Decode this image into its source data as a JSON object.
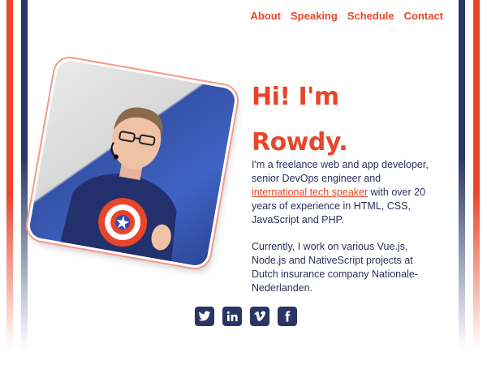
{
  "nav": {
    "items": [
      {
        "label": "About"
      },
      {
        "label": "Speaking"
      },
      {
        "label": "Schedule"
      },
      {
        "label": "Contact"
      }
    ]
  },
  "hero": {
    "heading_line1": "Hi! I'm",
    "heading_line2": "Rowdy.",
    "para1_before": "I'm a freelance web and app developer, senior DevOps engineer and ",
    "para1_link": "international tech speaker",
    "para1_after": " with over 20 years of experience in HTML, CSS, JavaScript and PHP.",
    "para2": "Currently, I work on various Vue.js, Node.js and NativeScript projects at Dutch insurance company Nationale-Nederlanden."
  },
  "social": [
    {
      "icon": "twitter-icon"
    },
    {
      "icon": "linkedin-icon"
    },
    {
      "icon": "vimeo-icon"
    },
    {
      "icon": "facebook-icon"
    }
  ],
  "colors": {
    "accent": "#e8452a",
    "navy": "#2b3466",
    "text": "#2b2f5c"
  }
}
